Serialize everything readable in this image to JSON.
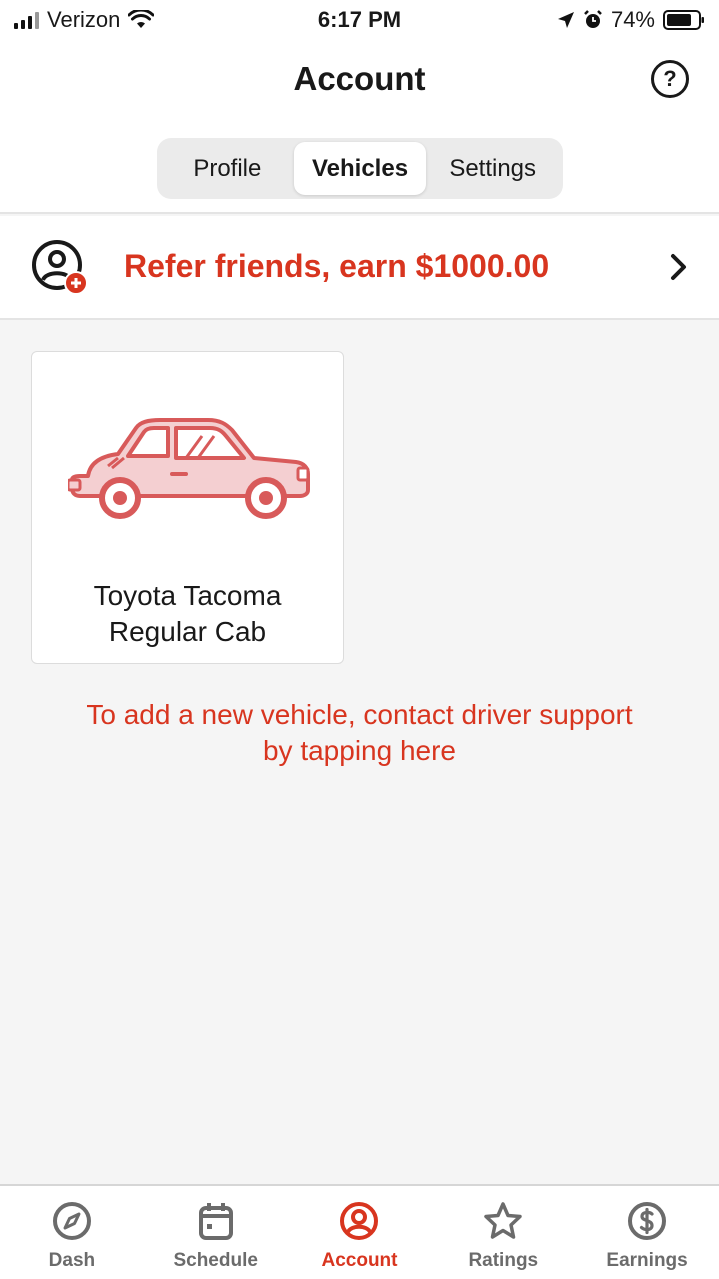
{
  "status_bar": {
    "carrier": "Verizon",
    "time": "6:17 PM",
    "battery": "74%"
  },
  "header": {
    "title": "Account",
    "help_icon": "question-circle-icon"
  },
  "tabs": [
    {
      "label": "Profile",
      "active": false
    },
    {
      "label": "Vehicles",
      "active": true
    },
    {
      "label": "Settings",
      "active": false
    }
  ],
  "referral": {
    "text": "Refer friends, earn $1000.00",
    "icon": "person-plus-icon"
  },
  "vehicle": {
    "name_line1": "Toyota Tacoma",
    "name_line2": "Regular Cab",
    "icon": "car-icon"
  },
  "support": {
    "line1": "To add a new vehicle, contact driver support",
    "line2": "by tapping here"
  },
  "bottom_nav": [
    {
      "label": "Dash",
      "icon": "compass-icon",
      "active": false
    },
    {
      "label": "Schedule",
      "icon": "calendar-icon",
      "active": false
    },
    {
      "label": "Account",
      "icon": "account-icon",
      "active": true
    },
    {
      "label": "Ratings",
      "icon": "star-icon",
      "active": false
    },
    {
      "label": "Earnings",
      "icon": "dollar-icon",
      "active": false
    }
  ],
  "colors": {
    "accent": "#d8351f",
    "background": "#f5f5f5",
    "text": "#191919",
    "inactive": "#6b6b6b"
  }
}
